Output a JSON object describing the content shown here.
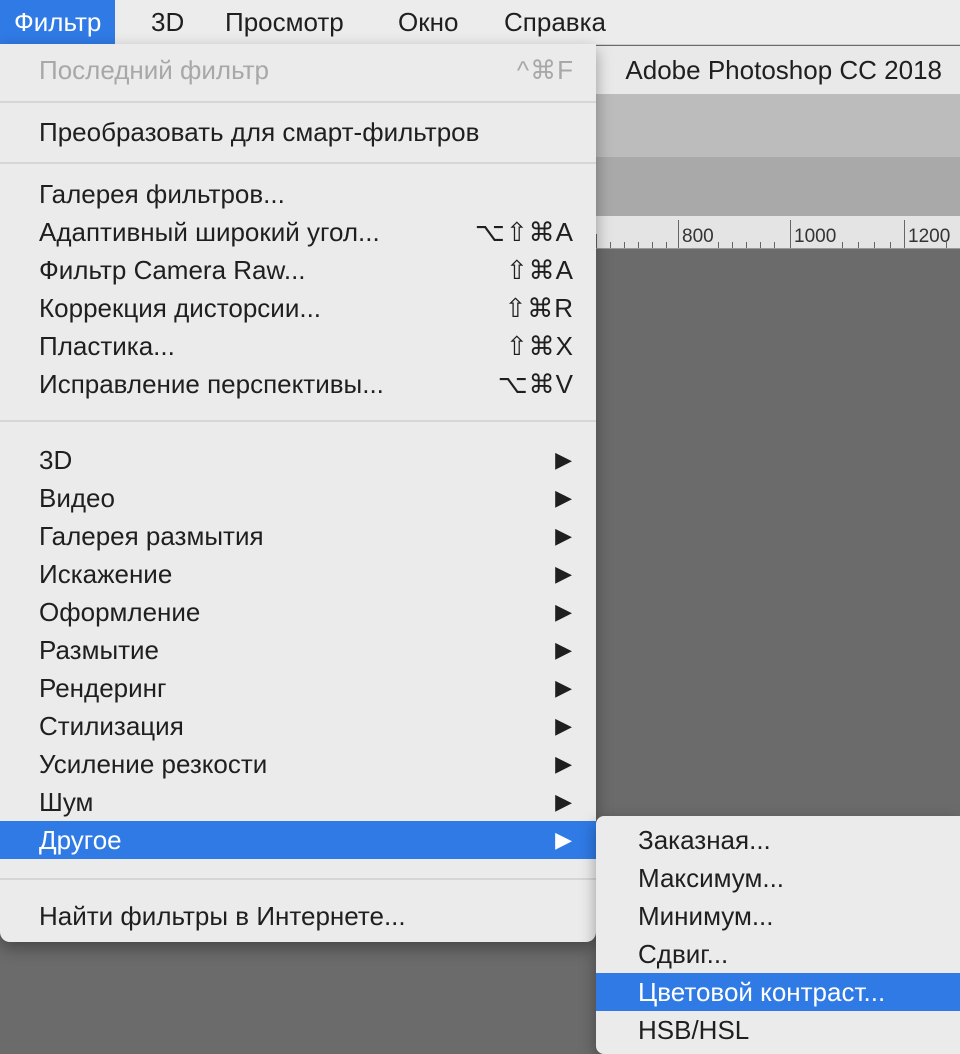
{
  "menubar": {
    "items": [
      {
        "label": "Фильтр",
        "active": true
      },
      {
        "label": "3D"
      },
      {
        "label": "Просмотр"
      },
      {
        "label": "Окно"
      },
      {
        "label": "Справка"
      }
    ]
  },
  "app": {
    "title": "Adobe Photoshop CC 2018",
    "ruler_labels": [
      "800",
      "1000",
      "1200"
    ]
  },
  "filter_menu": {
    "last_filter": {
      "label": "Последний фильтр",
      "shortcut": "^⌘F",
      "disabled": true
    },
    "convert_smart": {
      "label": "Преобразовать для смарт-фильтров"
    },
    "group_tools": [
      {
        "label": "Галерея фильтров...",
        "shortcut": ""
      },
      {
        "label": "Адаптивный широкий угол...",
        "shortcut": "⌥⇧⌘A"
      },
      {
        "label": "Фильтр Camera Raw...",
        "shortcut": "⇧⌘A"
      },
      {
        "label": "Коррекция дисторсии...",
        "shortcut": "⇧⌘R"
      },
      {
        "label": "Пластика...",
        "shortcut": "⇧⌘X"
      },
      {
        "label": "Исправление перспективы...",
        "shortcut": "⌥⌘V"
      }
    ],
    "submenus": [
      {
        "label": "3D"
      },
      {
        "label": "Видео"
      },
      {
        "label": "Галерея размытия"
      },
      {
        "label": "Искажение"
      },
      {
        "label": "Оформление"
      },
      {
        "label": "Размытие"
      },
      {
        "label": "Рендеринг"
      },
      {
        "label": "Стилизация"
      },
      {
        "label": "Усиление резкости"
      },
      {
        "label": "Шум"
      },
      {
        "label": "Другое",
        "highlighted": true
      }
    ],
    "submenu_arrow": "▶",
    "find_online": {
      "label": "Найти фильтры в Интернете..."
    }
  },
  "other_submenu": {
    "items": [
      {
        "label": "Заказная..."
      },
      {
        "label": "Максимум..."
      },
      {
        "label": "Минимум..."
      },
      {
        "label": "Сдвиг..."
      },
      {
        "label": "Цветовой контраст...",
        "highlighted": true
      },
      {
        "label": "HSB/HSL"
      }
    ]
  },
  "colors": {
    "highlight": "#2f7ae5",
    "menu_bg": "#ebebeb",
    "canvas_bg": "#6b6b6b"
  }
}
